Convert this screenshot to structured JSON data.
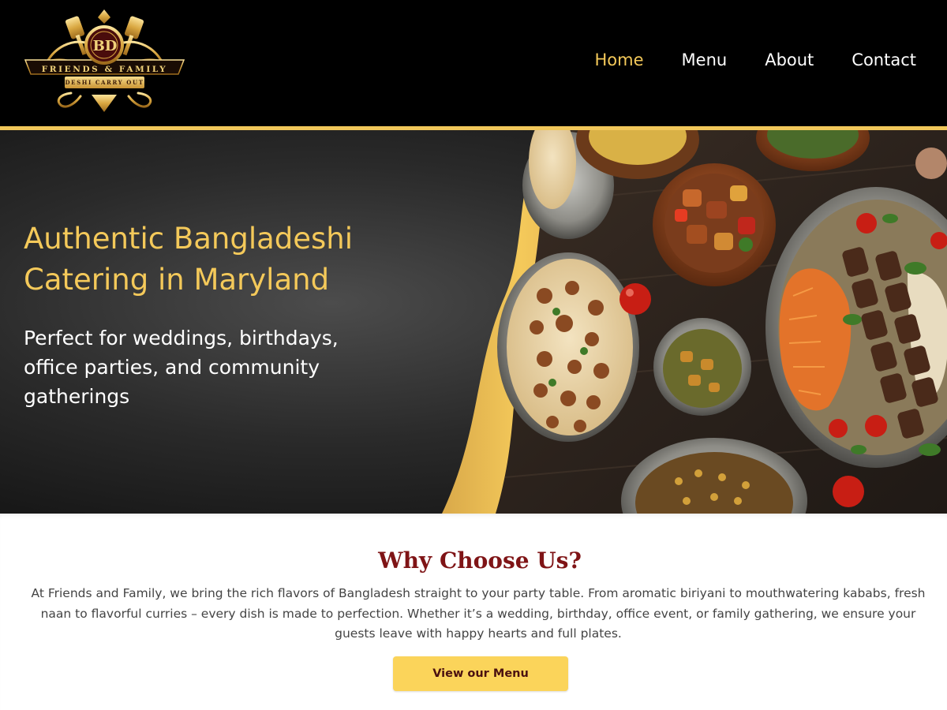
{
  "brand": {
    "monogram": "BD",
    "name": "FRIENDS & FAMILY",
    "tagline": "DESHI CARRY OUT"
  },
  "nav": {
    "items": [
      {
        "label": "Home",
        "active": true
      },
      {
        "label": "Menu",
        "active": false
      },
      {
        "label": "About",
        "active": false
      },
      {
        "label": "Contact",
        "active": false
      }
    ]
  },
  "hero": {
    "title": "Authentic Bangladeshi Catering in Maryland",
    "subtitle": "Perfect for weddings, birthdays, office parties, and community gatherings",
    "image": "food-spread-illustration"
  },
  "why": {
    "title": "Why Choose Us?",
    "body": "At Friends and Family, we bring the rich flavors of Bangladesh straight to your party table. From aromatic biriyani to mouthwatering kababs, fresh naan to flavorful curries – every dish is made to perfection. Whether it’s a wedding, birthday, office event, or family gathering, we ensure your guests leave with happy hearts and full plates.",
    "button_label": "View our Menu"
  },
  "colors": {
    "header_bg": "#000000",
    "accent_gold": "#f4c95a",
    "heading_maroon": "#7f1416",
    "button_bg": "#fbd45a"
  }
}
